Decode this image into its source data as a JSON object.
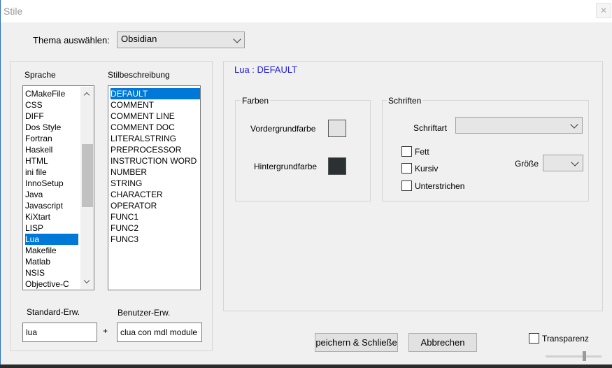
{
  "window": {
    "title": "Stile",
    "close_glyph": "✕"
  },
  "theme": {
    "label": "Thema auswählen:",
    "value": "Obsidian"
  },
  "languages": {
    "header": "Sprache",
    "items": [
      "CMakeFile",
      "CSS",
      "DIFF",
      "Dos Style",
      "Fortran",
      "Haskell",
      "HTML",
      "ini file",
      "InnoSetup",
      "Java",
      "Javascript",
      "KiXtart",
      "LISP",
      "Lua",
      "Makefile",
      "Matlab",
      "NSIS",
      "Objective-C"
    ],
    "selected": "Lua"
  },
  "styles": {
    "header": "Stilbeschreibung",
    "items": [
      "DEFAULT",
      "COMMENT",
      "COMMENT LINE",
      "COMMENT DOC",
      "LITERALSTRING",
      "PREPROCESSOR",
      "INSTRUCTION WORD",
      "NUMBER",
      "STRING",
      "CHARACTER",
      "OPERATOR",
      "FUNC1",
      "FUNC2",
      "FUNC3"
    ],
    "selected": "DEFAULT"
  },
  "extensions": {
    "default_label": "Standard-Erw.",
    "default_value": "lua",
    "plus": "+",
    "user_label": "Benutzer-Erw.",
    "user_value": "clua con mdl module"
  },
  "style_header": "Lua : DEFAULT",
  "colors": {
    "group_label": "Farben",
    "fg_label": "Vordergrundfarbe",
    "fg_color": "#e3e3e3",
    "bg_label": "Hintergrundfarbe",
    "bg_color": "#2b3033"
  },
  "fonts": {
    "group_label": "Schriften",
    "font_label": "Schriftart",
    "font_value": "",
    "bold_label": "Fett",
    "italic_label": "Kursiv",
    "underline_label": "Unterstrichen",
    "size_label": "Größe",
    "size_value": ""
  },
  "buttons": {
    "save": "peichern & Schließe",
    "cancel": "Abbrechen"
  },
  "transparency": {
    "label": "Transparenz",
    "checked": false
  },
  "accent": "#0078d7"
}
